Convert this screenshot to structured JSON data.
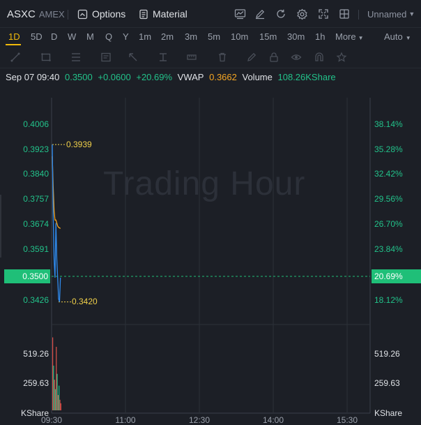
{
  "header": {
    "symbol": "ASXC",
    "exchange": "AMEX",
    "options_label": "Options",
    "material_label": "Material",
    "layout_name": "Unnamed"
  },
  "intervals": {
    "items": [
      "1D",
      "5D",
      "D",
      "W",
      "M",
      "Q",
      "Y",
      "1m",
      "2m",
      "3m",
      "5m",
      "10m",
      "15m",
      "30m",
      "1h"
    ],
    "active": "1D",
    "more_label": "More",
    "auto_label": "Auto"
  },
  "info": {
    "datetime": "Sep 07 09:40",
    "price": "0.3500",
    "change": "+0.0600",
    "change_pct": "+20.69%",
    "vwap_label": "VWAP",
    "vwap_value": "0.3662",
    "volume_label": "Volume",
    "volume_value": "108.26KShare"
  },
  "chart_data": {
    "type": "line",
    "watermark": "Trading Hour",
    "price_axis": [
      "0.4006",
      "0.3923",
      "0.3840",
      "0.3757",
      "0.3674",
      "0.3591",
      "0.3426"
    ],
    "percent_axis": [
      "38.14%",
      "35.28%",
      "32.42%",
      "29.56%",
      "26.70%",
      "23.84%",
      "18.12%"
    ],
    "current_price": "0.3500",
    "current_pct": "20.69%",
    "high_label": "0.3939",
    "low_label": "0.3420",
    "volume_axis": [
      "519.26",
      "259.63"
    ],
    "volume_unit": "KShare",
    "x_ticks": [
      "09:30",
      "11:00",
      "12:30",
      "14:00",
      "15:30"
    ],
    "price_series": {
      "name": "Price",
      "color": "#2f8cf0",
      "points": [
        [
          0,
          0.3939
        ],
        [
          1,
          0.37
        ],
        [
          2,
          0.356
        ],
        [
          3,
          0.35
        ],
        [
          4,
          0.368
        ],
        [
          5,
          0.356
        ],
        [
          6,
          0.3495
        ],
        [
          7,
          0.343
        ],
        [
          8,
          0.342
        ],
        [
          9,
          0.35
        ]
      ]
    },
    "vwap_series": {
      "name": "VWAP",
      "color": "#f5a623",
      "points": [
        [
          0,
          0.39
        ],
        [
          1,
          0.38
        ],
        [
          2,
          0.372
        ],
        [
          3,
          0.369
        ],
        [
          4,
          0.369
        ],
        [
          5,
          0.368
        ],
        [
          6,
          0.367
        ],
        [
          7,
          0.3666
        ],
        [
          8,
          0.3664
        ],
        [
          9,
          0.3662
        ]
      ]
    },
    "volume_bars": [
      {
        "v": 620,
        "c": "#e0524a"
      },
      {
        "v": 380,
        "c": "#22c28a"
      },
      {
        "v": 260,
        "c": "#e0524a"
      },
      {
        "v": 180,
        "c": "#22c28a"
      },
      {
        "v": 540,
        "c": "#e0524a"
      },
      {
        "v": 310,
        "c": "#22c28a"
      },
      {
        "v": 130,
        "c": "#e0524a"
      },
      {
        "v": 210,
        "c": "#22c28a"
      },
      {
        "v": 90,
        "c": "#e0524a"
      },
      {
        "v": 60,
        "c": "#e0524a"
      }
    ]
  },
  "colors": {
    "accent": "#f0b90b",
    "up": "#22c28a",
    "down": "#e0524a",
    "vwap": "#f5a623",
    "grid": "#2c3038"
  }
}
